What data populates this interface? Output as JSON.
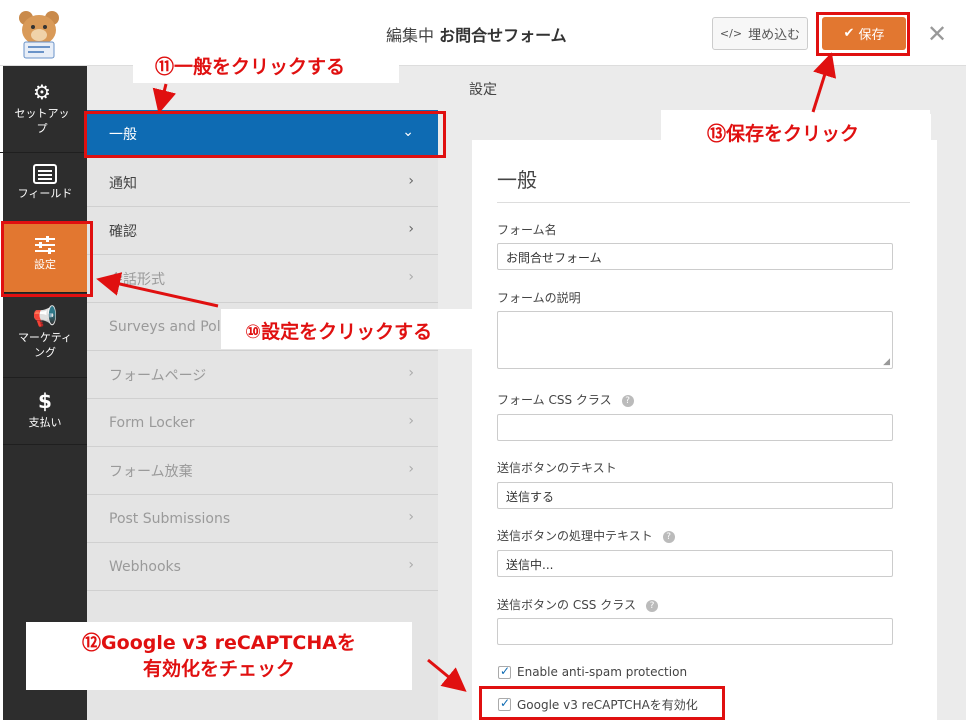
{
  "header": {
    "title_prefix": "編集中",
    "title_form": "お問合せフォーム",
    "embed_label": "埋め込む",
    "save_label": "保存",
    "close_label": "✕"
  },
  "leftnav": [
    {
      "label": "セットアッ\nプ",
      "icon": "gear-icon"
    },
    {
      "label": "フィールド",
      "icon": "fields-list-icon"
    },
    {
      "label": "設定",
      "icon": "sliders-icon"
    },
    {
      "label": "マーケティ\nング",
      "icon": "megaphone-icon"
    },
    {
      "label": "支払い",
      "icon": "dollar-icon"
    }
  ],
  "settings_title": "設定",
  "sections": [
    {
      "label": "一般"
    },
    {
      "label": "通知"
    },
    {
      "label": "確認"
    },
    {
      "label": "会話形式"
    },
    {
      "label": "Surveys and Polls"
    },
    {
      "label": "フォームページ"
    },
    {
      "label": "Form Locker"
    },
    {
      "label": "フォーム放棄"
    },
    {
      "label": "Post Submissions"
    },
    {
      "label": "Webhooks"
    }
  ],
  "form": {
    "heading": "一般",
    "form_name_label": "フォーム名",
    "form_name_value": "お問合せフォーム",
    "form_desc_label": "フォームの説明",
    "form_css_label": "フォーム CSS クラス",
    "submit_text_label": "送信ボタンのテキスト",
    "submit_text_value": "送信する",
    "processing_text_label": "送信ボタンの処理中テキスト",
    "processing_text_value": "送信中...",
    "submit_css_label": "送信ボタンの CSS クラス",
    "antispam_label": "Enable anti-spam protection",
    "recaptcha_label": "Google v3 reCAPTCHAを有効化"
  },
  "annotations": {
    "step10": "⑩設定をクリックする",
    "step11": "⑪一般をクリックする",
    "step12_line1": "⑫Google v3 reCAPTCHAを",
    "step12_line2": "有効化をチェック",
    "step13": "⑬保存をクリック"
  },
  "colors": {
    "accent_orange": "#e27730",
    "active_blue": "#0e6bb3",
    "annotation_red": "#e01010"
  }
}
